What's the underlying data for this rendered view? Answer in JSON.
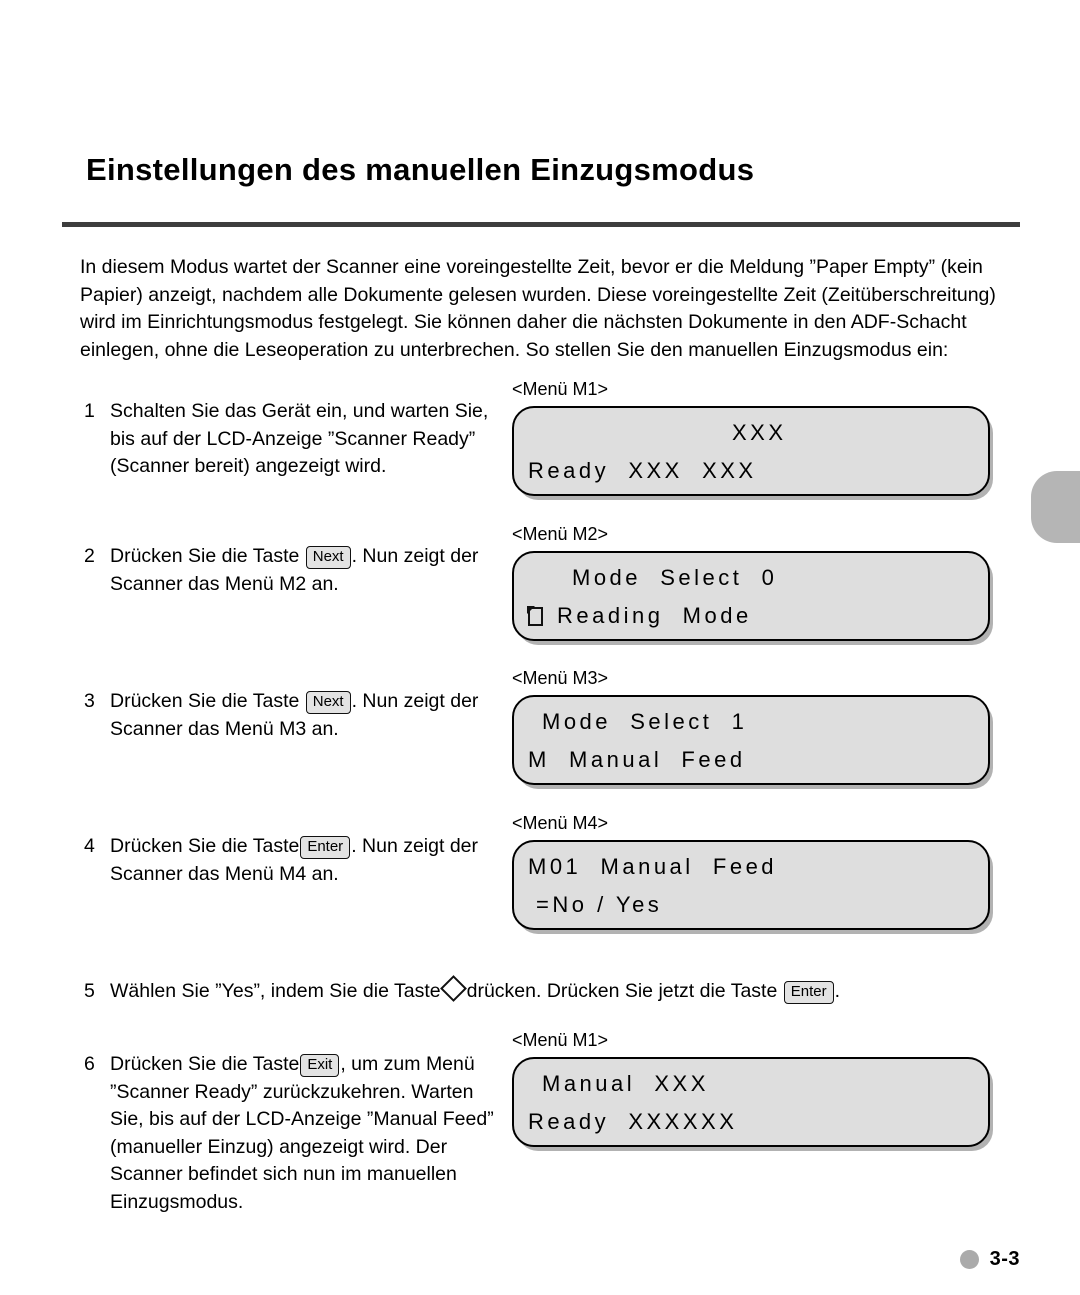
{
  "page": {
    "title": "Einstellungen des manuellen Einzugsmodus",
    "page_number": "3-3",
    "intro": "In diesem Modus wartet der Scanner eine voreingestellte Zeit, bevor er die Meldung ”Paper Empty” (kein Papier) anzeigt, nachdem alle Dokumente gelesen wurden. Diese voreingestellte Zeit (Zeitüberschreitung) wird im Einrichtungsmodus festgelegt. Sie können daher die nächsten Dokumente in den ADF-Schacht einlegen, ohne die Leseoperation zu unterbrechen. So stellen Sie den manuellen Einzugsmodus ein:"
  },
  "keys": {
    "next": "Next",
    "enter": "Enter",
    "exit": "Exit"
  },
  "steps": {
    "s1": {
      "num": "1",
      "text": "Schalten Sie das Gerät ein, und warten Sie, bis auf der LCD-Anzeige ”Scanner Ready” (Scanner bereit) angezeigt wird."
    },
    "s2": {
      "num": "2",
      "prefix": "Drücken Sie die Taste ",
      "suffix": ". Nun zeigt der Scanner das Menü M2 an."
    },
    "s3": {
      "num": "3",
      "prefix": "Drücken Sie die Taste ",
      "suffix": ". Nun zeigt der Scanner das Menü M3 an."
    },
    "s4": {
      "num": "4",
      "prefix": "Drücken Sie die Taste",
      "suffix": ". Nun zeigt der Scanner das Menü M4 an."
    },
    "s5": {
      "num": "5",
      "prefix": "Wählen Sie ”Yes”, indem Sie die Taste",
      "middle": "drücken. Drücken Sie jetzt die Taste",
      "suffix": "."
    },
    "s6": {
      "num": "6",
      "prefix": "Drücken Sie die Taste",
      "suffix": ", um zum Menü ”Scanner Ready” zurückzukehren. Warten Sie, bis auf der LCD-Anzeige ”Manual Feed” (manueller Einzug) angezeigt wird. Der Scanner befindet sich nun im manuellen Einzugsmodus."
    }
  },
  "lcd": {
    "m1_first": {
      "caption": "<Menü M1>",
      "line1": "XXX",
      "line2": "Ready  XXX  XXX"
    },
    "m2": {
      "caption": "<Menü M2>",
      "line1": "Mode  Select  0",
      "line2": "Reading  Mode",
      "line2_icon": "page-icon"
    },
    "m3": {
      "caption": "<Menü M3>",
      "line1": "Mode  Select  1",
      "line2": "M  Manual  Feed"
    },
    "m4": {
      "caption": "<Menü M4>",
      "line1": "M01  Manual  Feed",
      "line2": "=No / Yes"
    },
    "m1_last": {
      "caption": "<Menü M1>",
      "line1": "Manual  XXX",
      "line2": "Ready  XXXXXX"
    }
  },
  "colors": {
    "rule": "#3d3d3d",
    "lcd_fill": "#dedede",
    "keycap_fill": "#e3e3e3",
    "edge_tab": "#b5b5b5",
    "footer_dot": "#aaaaaa"
  }
}
